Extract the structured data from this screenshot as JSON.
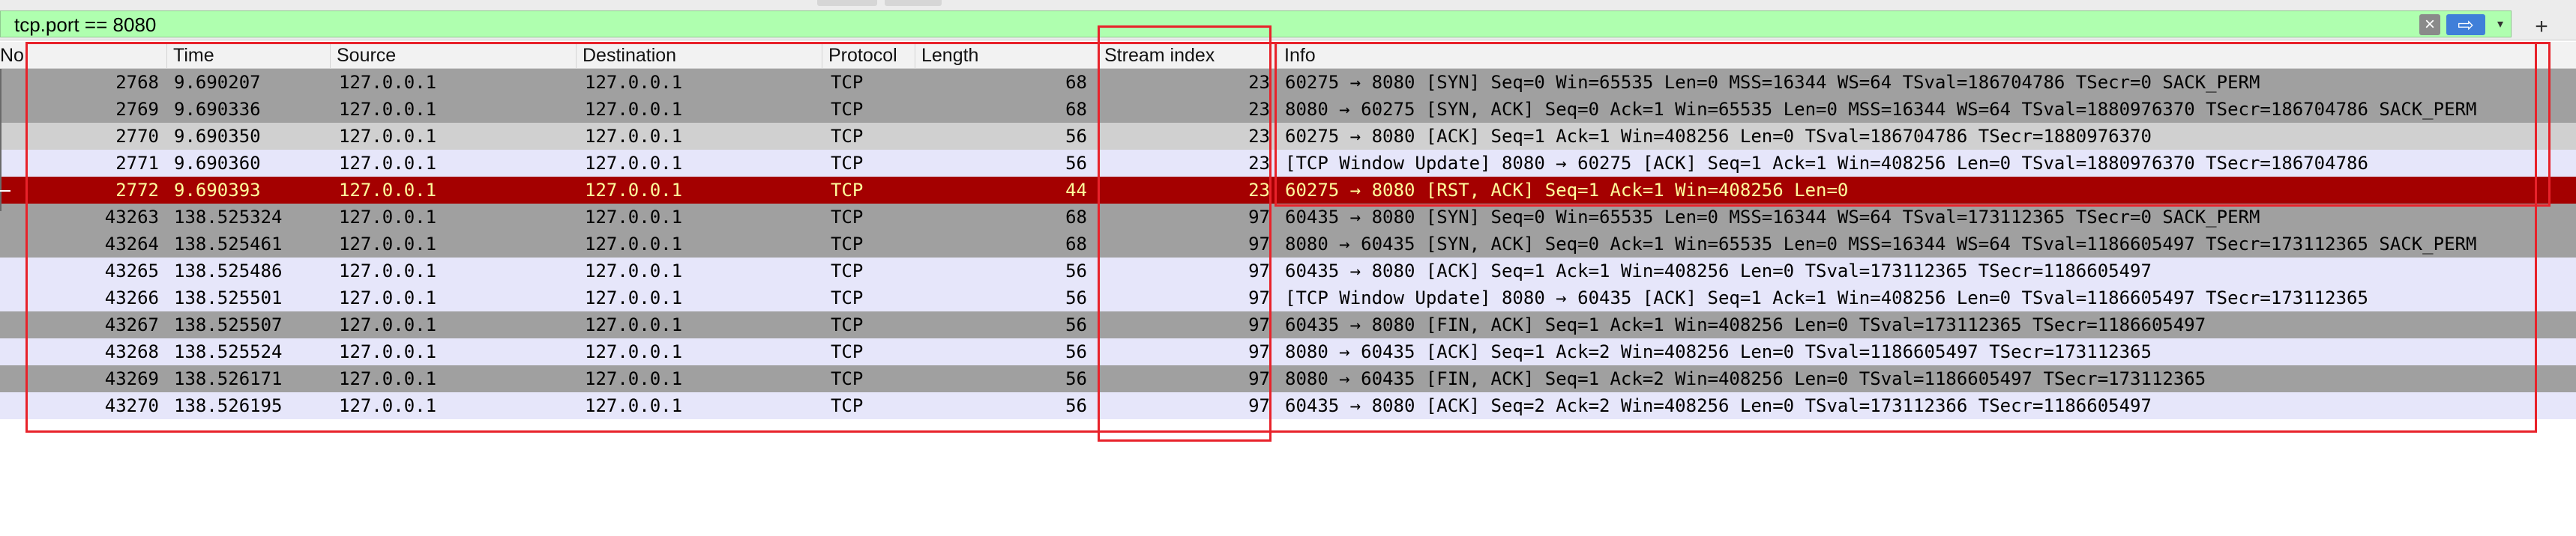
{
  "filter": {
    "value": "tcp.port == 8080",
    "clear_glyph": "×",
    "apply_glyph": "⇨",
    "dropdown_glyph": "▾",
    "add_glyph": "+"
  },
  "columns": {
    "no": "No.",
    "time": "Time",
    "source": "Source",
    "destination": "Destination",
    "protocol": "Protocol",
    "length": "Length",
    "stream": "Stream index",
    "info": "Info"
  },
  "colors": {
    "filter_ok": "#afffaf",
    "row_dark": "#a0a0a0",
    "row_light": "#e6e6fa",
    "row_selected": "#a40000",
    "selected_text": "#fffc9c",
    "annotation": "#e8222a"
  },
  "packets": [
    {
      "no": "2768",
      "time": "9.690207",
      "src": "127.0.0.1",
      "dst": "127.0.0.1",
      "proto": "TCP",
      "len": "68",
      "stream": "23",
      "info": "60275 → 8080 [SYN] Seq=0 Win=65535 Len=0 MSS=16344 WS=64 TSval=186704786 TSecr=0 SACK_PERM"
    },
    {
      "no": "2769",
      "time": "9.690336",
      "src": "127.0.0.1",
      "dst": "127.0.0.1",
      "proto": "TCP",
      "len": "68",
      "stream": "23",
      "info": "8080 → 60275 [SYN, ACK] Seq=0 Ack=1 Win=65535 Len=0 MSS=16344 WS=64 TSval=1880976370 TSecr=186704786 SACK_PERM"
    },
    {
      "no": "2770",
      "time": "9.690350",
      "src": "127.0.0.1",
      "dst": "127.0.0.1",
      "proto": "TCP",
      "len": "56",
      "stream": "23",
      "info": "60275 → 8080 [ACK] Seq=1 Ack=1 Win=408256 Len=0 TSval=186704786 TSecr=1880976370"
    },
    {
      "no": "2771",
      "time": "9.690360",
      "src": "127.0.0.1",
      "dst": "127.0.0.1",
      "proto": "TCP",
      "len": "56",
      "stream": "23",
      "info": "[TCP Window Update] 8080 → 60275 [ACK] Seq=1 Ack=1 Win=408256 Len=0 TSval=1880976370 TSecr=186704786"
    },
    {
      "no": "2772",
      "time": "9.690393",
      "src": "127.0.0.1",
      "dst": "127.0.0.1",
      "proto": "TCP",
      "len": "44",
      "stream": "23",
      "info": "60275 → 8080 [RST, ACK] Seq=1 Ack=1 Win=408256 Len=0"
    },
    {
      "no": "43263",
      "time": "138.525324",
      "src": "127.0.0.1",
      "dst": "127.0.0.1",
      "proto": "TCP",
      "len": "68",
      "stream": "97",
      "info": "60435 → 8080 [SYN] Seq=0 Win=65535 Len=0 MSS=16344 WS=64 TSval=173112365 TSecr=0 SACK_PERM"
    },
    {
      "no": "43264",
      "time": "138.525461",
      "src": "127.0.0.1",
      "dst": "127.0.0.1",
      "proto": "TCP",
      "len": "68",
      "stream": "97",
      "info": "8080 → 60435 [SYN, ACK] Seq=0 Ack=1 Win=65535 Len=0 MSS=16344 WS=64 TSval=1186605497 TSecr=173112365 SACK_PERM"
    },
    {
      "no": "43265",
      "time": "138.525486",
      "src": "127.0.0.1",
      "dst": "127.0.0.1",
      "proto": "TCP",
      "len": "56",
      "stream": "97",
      "info": "60435 → 8080 [ACK] Seq=1 Ack=1 Win=408256 Len=0 TSval=173112365 TSecr=1186605497"
    },
    {
      "no": "43266",
      "time": "138.525501",
      "src": "127.0.0.1",
      "dst": "127.0.0.1",
      "proto": "TCP",
      "len": "56",
      "stream": "97",
      "info": "[TCP Window Update] 8080 → 60435 [ACK] Seq=1 Ack=1 Win=408256 Len=0 TSval=1186605497 TSecr=173112365"
    },
    {
      "no": "43267",
      "time": "138.525507",
      "src": "127.0.0.1",
      "dst": "127.0.0.1",
      "proto": "TCP",
      "len": "56",
      "stream": "97",
      "info": "60435 → 8080 [FIN, ACK] Seq=1 Ack=1 Win=408256 Len=0 TSval=173112365 TSecr=1186605497"
    },
    {
      "no": "43268",
      "time": "138.525524",
      "src": "127.0.0.1",
      "dst": "127.0.0.1",
      "proto": "TCP",
      "len": "56",
      "stream": "97",
      "info": "8080 → 60435 [ACK] Seq=1 Ack=2 Win=408256 Len=0 TSval=1186605497 TSecr=173112365"
    },
    {
      "no": "43269",
      "time": "138.526171",
      "src": "127.0.0.1",
      "dst": "127.0.0.1",
      "proto": "TCP",
      "len": "56",
      "stream": "97",
      "info": "8080 → 60435 [FIN, ACK] Seq=1 Ack=2 Win=408256 Len=0 TSval=1186605497 TSecr=173112365"
    },
    {
      "no": "43270",
      "time": "138.526195",
      "src": "127.0.0.1",
      "dst": "127.0.0.1",
      "proto": "TCP",
      "len": "56",
      "stream": "97",
      "info": "60435 → 8080 [ACK] Seq=2 Ack=2 Win=408256 Len=0 TSval=173112366 TSecr=1186605497"
    }
  ]
}
